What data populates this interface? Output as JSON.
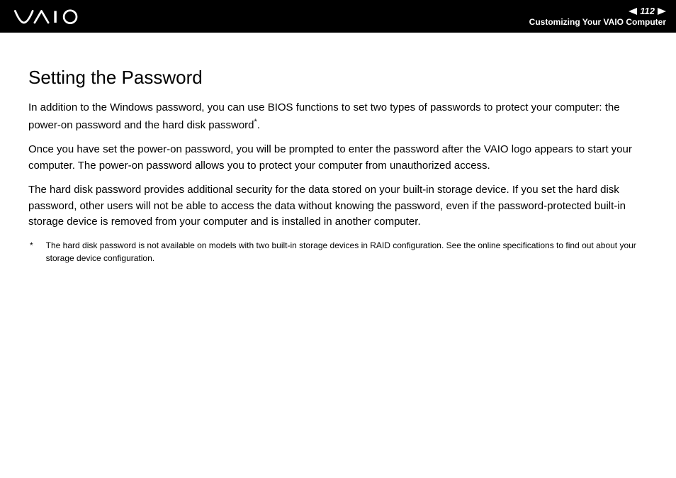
{
  "header": {
    "page_number": "112",
    "section_label": "Customizing Your VAIO Computer"
  },
  "content": {
    "title": "Setting the Password",
    "paragraphs": [
      "In addition to the Windows password, you can use BIOS functions to set two types of passwords to protect your computer: the power-on password and the hard disk password",
      "Once you have set the power-on password, you will be prompted to enter the password after the VAIO logo appears to start your computer. The power-on password allows you to protect your computer from unauthorized access.",
      "The hard disk password provides additional security for the data stored on your built-in storage device. If you set the hard disk password, other users will not be able to access the data without knowing the password, even if the password-protected built-in storage device is removed from your computer and is installed in another computer."
    ],
    "footnote_ref": "*",
    "para1_suffix": ".",
    "footnote": {
      "marker": "*",
      "text": "The hard disk password is not available on models with two built-in storage devices in RAID configuration. See the online specifications to find out about your storage device configuration."
    }
  }
}
